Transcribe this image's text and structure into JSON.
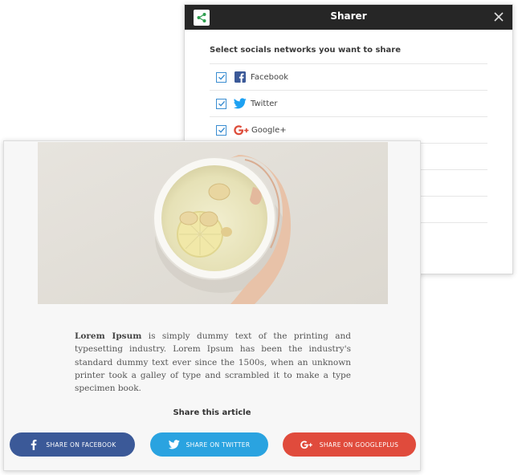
{
  "dialog": {
    "title": "Sharer",
    "instruction": "Select socials networks you want to share",
    "networks": [
      {
        "label": "Facebook",
        "checked": true,
        "icon": "facebook-icon",
        "color": "#3b5998"
      },
      {
        "label": "Twitter",
        "checked": true,
        "icon": "twitter-icon",
        "color": "#1da1f2"
      },
      {
        "label": "Google+",
        "checked": true,
        "icon": "google-plus-icon",
        "color": "#dd4b39"
      },
      {
        "label": "",
        "checked": false,
        "icon": ""
      },
      {
        "label": "",
        "checked": false,
        "icon": ""
      },
      {
        "label": "",
        "checked": false,
        "icon": ""
      }
    ]
  },
  "article": {
    "lead": "Lorem Ipsum",
    "body": " is simply dummy text of the printing and typesetting industry. Lorem Ipsum has been the industry's standard dummy text ever since the 1500s, when an unknown printer took a galley of type and scrambled it to make a type specimen book.",
    "share_title": "Share this article",
    "buttons": {
      "facebook": {
        "label": "SHARE ON FACEBOOK",
        "color": "#3b5998"
      },
      "twitter": {
        "label": "SHARE ON TWITTER",
        "color": "#2aa3e0"
      },
      "googleplus": {
        "label": "SHARE ON GOOGLEPLUS",
        "color": "#e04b3c"
      }
    }
  }
}
